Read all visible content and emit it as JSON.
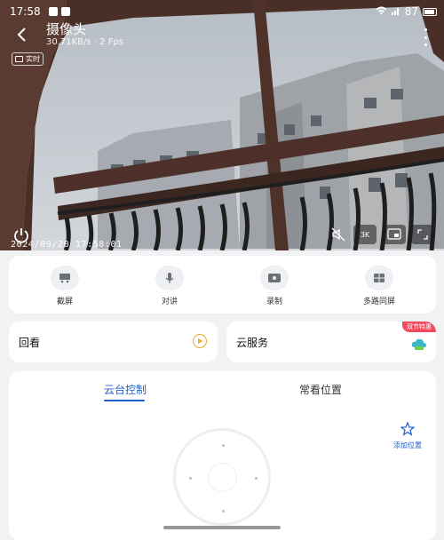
{
  "status_bar": {
    "time": "17:58",
    "battery": "87"
  },
  "camera": {
    "title": "摄像头",
    "data_rate": "30.71KB/s · 2 Fps",
    "live_label": "实时",
    "osd_timestamp": "2024/09/20 17:58:01",
    "resolution_label": "3K"
  },
  "tools": [
    {
      "label": "截屏",
      "icon": "screenshot-icon"
    },
    {
      "label": "对讲",
      "icon": "microphone-icon"
    },
    {
      "label": "录制",
      "icon": "record-icon"
    },
    {
      "label": "多路同屏",
      "icon": "multi-screen-icon"
    }
  ],
  "replay": {
    "label": "回看",
    "icon": "play-icon",
    "accent": "#f5a623"
  },
  "cloud_service": {
    "label": "云服务",
    "promo_badge": "双节特惠",
    "icon": "cloud-service-icon",
    "badge_color": "#f24a5c"
  },
  "ptz": {
    "tabs": [
      "云台控制",
      "常看位置"
    ],
    "active_tab": 0,
    "add_position_label": "添加位置",
    "accent": "#1f5fcf"
  }
}
